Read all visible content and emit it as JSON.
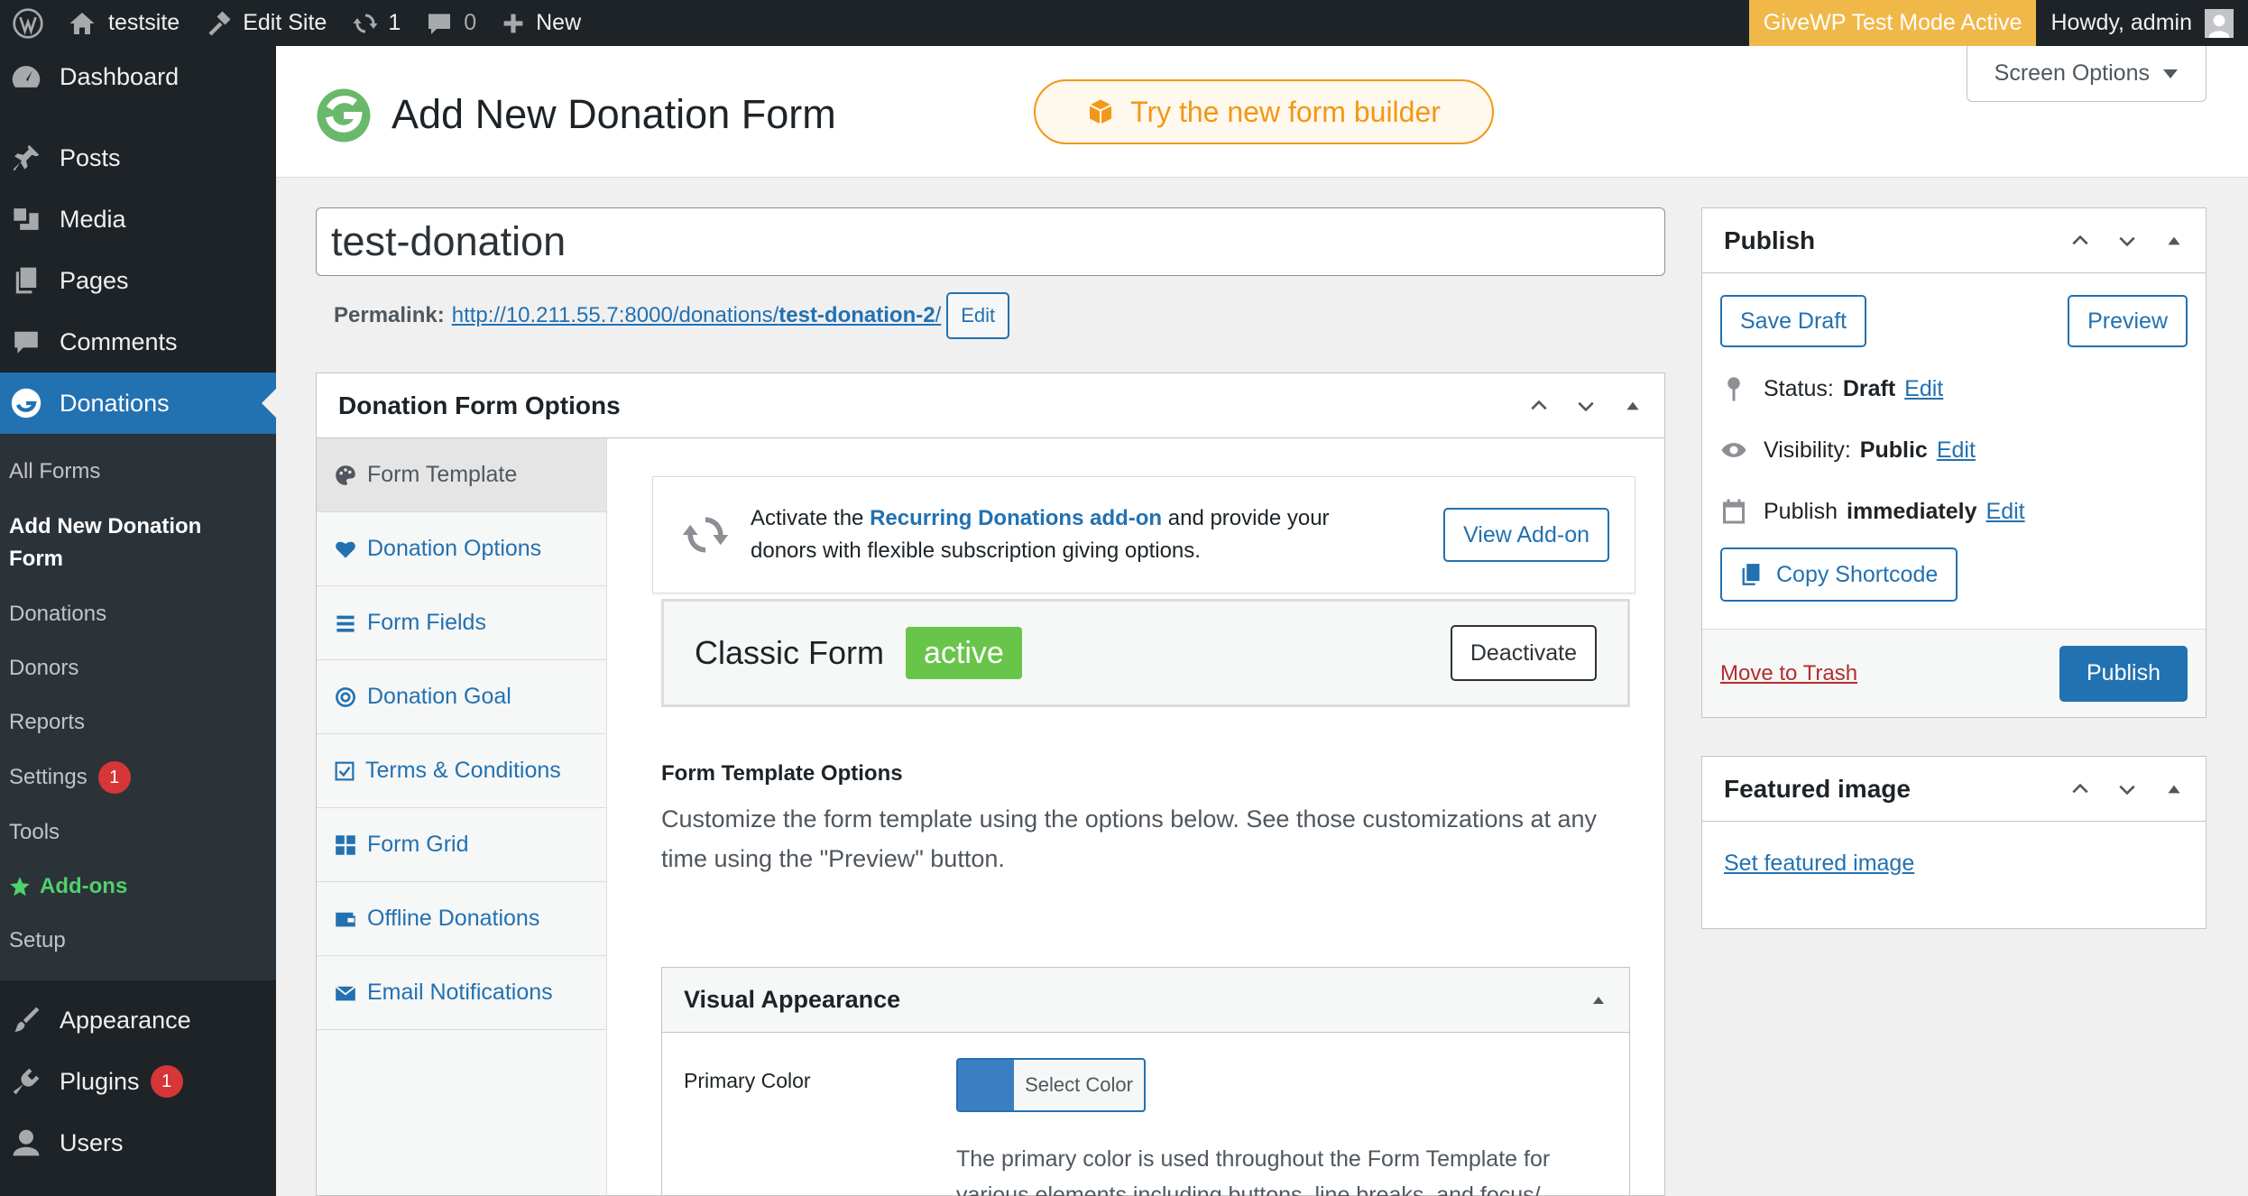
{
  "adminbar": {
    "site_name": "testsite",
    "edit_site": "Edit Site",
    "updates_count": "1",
    "comments_count": "0",
    "new_label": "New",
    "givewp_notice": "GiveWP Test Mode Active",
    "howdy": "Howdy, admin"
  },
  "sidebar": {
    "dashboard": "Dashboard",
    "posts": "Posts",
    "media": "Media",
    "pages": "Pages",
    "comments": "Comments",
    "donations": "Donations",
    "submenu": {
      "all_forms": "All Forms",
      "add_new": "Add New Donation Form",
      "donations": "Donations",
      "donors": "Donors",
      "reports": "Reports",
      "settings": "Settings",
      "settings_badge": "1",
      "tools": "Tools",
      "addons": "Add-ons",
      "setup": "Setup"
    },
    "appearance": "Appearance",
    "plugins": "Plugins",
    "plugins_badge": "1",
    "users": "Users"
  },
  "header": {
    "title": "Add New Donation Form",
    "try_builder": "Try the new form builder",
    "screen_options": "Screen Options"
  },
  "post": {
    "title_value": "test-donation",
    "permalink_label": "Permalink:",
    "permalink_base": "http://10.211.55.7:8000/donations/",
    "permalink_slug": "test-donation-2",
    "permalink_trail": "/",
    "edit_btn": "Edit"
  },
  "form_options": {
    "title": "Donation Form Options",
    "tabs": [
      "Form Template",
      "Donation Options",
      "Form Fields",
      "Donation Goal",
      "Terms & Conditions",
      "Form Grid",
      "Offline Donations",
      "Email Notifications"
    ],
    "recurring": {
      "pre": "Activate the ",
      "link": "Recurring Donations add-on",
      "post": " and provide your donors with flexible subscription giving options.",
      "button": "View Add-on"
    },
    "classic": {
      "name": "Classic Form",
      "status": "active",
      "button": "Deactivate"
    },
    "template_options": {
      "title": "Form Template Options",
      "desc": "Customize the form template using the options below. See those customizations at any time using the \"Preview\" button."
    },
    "visual": {
      "title": "Visual Appearance",
      "primary_color_label": "Primary Color",
      "select_color": "Select Color",
      "primary_color_value": "#3b7ec2",
      "primary_color_desc": "The primary color is used throughout the Form Template for various elements including buttons, line breaks, and focus/"
    }
  },
  "publish": {
    "title": "Publish",
    "save_draft": "Save Draft",
    "preview": "Preview",
    "status_label": "Status:",
    "status_value": "Draft",
    "visibility_label": "Visibility:",
    "visibility_value": "Public",
    "publish_label": "Publish",
    "publish_value": "immediately",
    "edit": "Edit",
    "copy_shortcode": "Copy Shortcode",
    "move_to_trash": "Move to Trash",
    "publish_btn": "Publish"
  },
  "featured": {
    "title": "Featured image",
    "link": "Set featured image"
  },
  "colors": {
    "accent": "#2271b1",
    "sidebar_bg": "#1d2327",
    "givewp_orange": "#f29718",
    "active_green": "#69c54a"
  }
}
